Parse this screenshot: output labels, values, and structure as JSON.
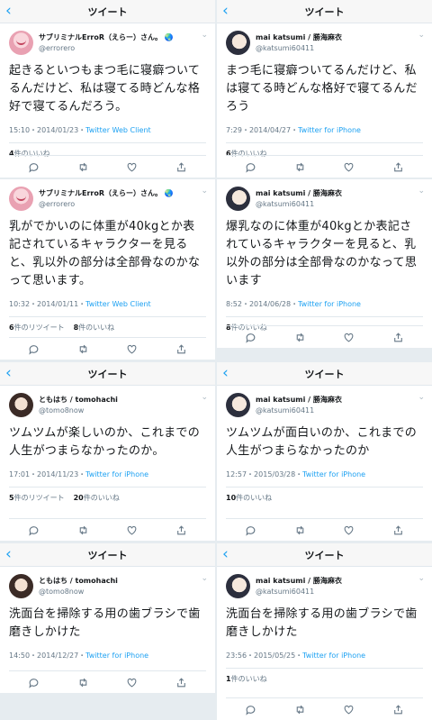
{
  "screen_title": "ツイート",
  "panels": [
    {
      "user": {
        "name": "サブリミナルErroR（えらー）さん。",
        "badge": "🌏",
        "handle": "@errorero"
      },
      "text": "起きるといつもまつ毛に寝癖ついてるんだけど、私は寝てる時どんな格好で寝てるんだろう。",
      "time": "15:10・2014/01/23・",
      "source": "Twitter Web Client",
      "retweets": "",
      "likes": "4",
      "retweet_label": "",
      "like_label": "件のいいね"
    },
    {
      "user": {
        "name": "mai katsumi / 勝海麻衣",
        "badge": "",
        "handle": "@katsumi60411"
      },
      "text": "まつ毛に寝癖ついてるんだけど、私は寝てる時どんな格好で寝てるんだろう",
      "time": "7:29・2014/04/27・",
      "source": "Twitter for iPhone",
      "retweets": "",
      "likes": "6",
      "retweet_label": "",
      "like_label": "件のいいね"
    },
    {
      "user": {
        "name": "サブリミナルErroR（えらー）さん。",
        "badge": "🌏",
        "handle": "@errorero"
      },
      "text": "乳がでかいのに体重が40kgとか表記されているキャラクターを見ると、乳以外の部分は全部骨なのかなって思います。",
      "time": "10:32・2014/01/11・",
      "source": "Twitter Web Client",
      "retweets": "6",
      "likes": "8",
      "retweet_label": "件のリツイート",
      "like_label": "件のいいね"
    },
    {
      "user": {
        "name": "mai katsumi / 勝海麻衣",
        "badge": "",
        "handle": "@katsumi60411"
      },
      "text": "爆乳なのに体重が40kgとか表記されているキャラクターを見ると、乳以外の部分は全部骨なのかなって思います",
      "time": "8:52・2014/06/28・",
      "source": "Twitter for iPhone",
      "retweets": "",
      "likes": "8",
      "retweet_label": "",
      "like_label": "件のいいね"
    },
    {
      "user": {
        "name": "ともはち / tomohachi",
        "badge": "",
        "handle": "@tomo8now"
      },
      "text": "ツムツムが楽しいのか、これまでの人生がつまらなかったのか。",
      "time": "17:01・2014/11/23・",
      "source": "Twitter for iPhone",
      "retweets": "5",
      "likes": "20",
      "retweet_label": "件のリツイート",
      "like_label": "件のいいね"
    },
    {
      "user": {
        "name": "mai katsumi / 勝海麻衣",
        "badge": "",
        "handle": "@katsumi60411"
      },
      "text": "ツムツムが面白いのか、これまでの人生がつまらなかったのか",
      "time": "12:57・2015/03/28・",
      "source": "Twitter for iPhone",
      "retweets": "",
      "likes": "10",
      "retweet_label": "",
      "like_label": "件のいいね"
    },
    {
      "user": {
        "name": "ともはち / tomohachi",
        "badge": "",
        "handle": "@tomo8now"
      },
      "text": "洗面台を掃除する用の歯ブラシで歯磨きしかけた",
      "time": "14:50・2014/12/27・",
      "source": "Twitter for iPhone",
      "retweets": "",
      "likes": "",
      "retweet_label": "",
      "like_label": ""
    },
    {
      "user": {
        "name": "mai katsumi / 勝海麻衣",
        "badge": "",
        "handle": "@katsumi60411"
      },
      "text": "洗面台を掃除する用の歯ブラシで歯磨きしかけた",
      "time": "23:56・2015/05/25・",
      "source": "Twitter for iPhone",
      "retweets": "",
      "likes": "1",
      "retweet_label": "",
      "like_label": "件のいいね"
    }
  ]
}
